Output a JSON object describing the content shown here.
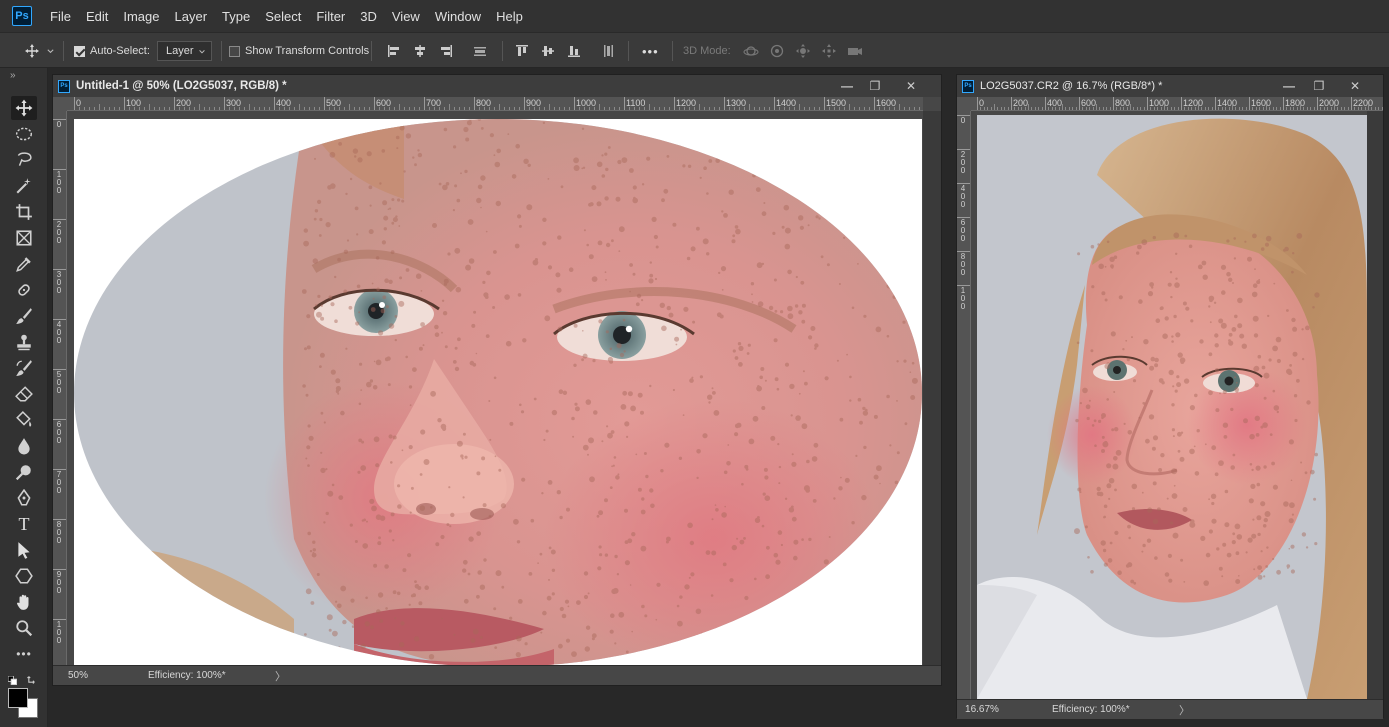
{
  "menu": [
    "File",
    "Edit",
    "Image",
    "Layer",
    "Type",
    "Select",
    "Filter",
    "3D",
    "View",
    "Window",
    "Help"
  ],
  "app_logo": "Ps",
  "options": {
    "auto_select_label": "Auto-Select:",
    "auto_select_checked": true,
    "auto_select_target": "Layer",
    "show_transform_label": "Show Transform Controls",
    "show_transform_checked": false,
    "more_label": "•••",
    "three_d_mode_label": "3D Mode:"
  },
  "toolbar": {
    "collapse_label": "»",
    "tools": [
      "move",
      "ellipse-marquee",
      "lasso",
      "magic-wand",
      "crop",
      "frame",
      "eyedropper",
      "healing",
      "brush",
      "clone-stamp",
      "history-brush",
      "eraser",
      "paint-bucket",
      "blur",
      "dodge",
      "pen",
      "type",
      "path-selection",
      "shape",
      "hand",
      "zoom",
      "more"
    ],
    "type_glyph": "T",
    "more_glyph": "•••",
    "foreground_color": "#000000",
    "background_color": "#ffffff"
  },
  "doc1": {
    "icon": "Ps",
    "title": "Untitled-1 @ 50% (LO2G5037, RGB/8) *",
    "ruler_h": [
      "0",
      "100",
      "200",
      "300",
      "400",
      "500",
      "600",
      "700",
      "800",
      "900",
      "1000",
      "1100",
      "1200",
      "1300",
      "1400",
      "1500",
      "1600"
    ],
    "ruler_v": [
      "0",
      "1\n0\n0",
      "2\n0\n0",
      "3\n0\n0",
      "4\n0\n0",
      "5\n0\n0",
      "6\n0\n0",
      "7\n0\n0",
      "8\n0\n0",
      "9\n0\n0",
      "1\n0\n0"
    ],
    "zoom": "50%",
    "efficiency": "Efficiency: 100%*",
    "arrow": "〉"
  },
  "doc2": {
    "icon": "Ps",
    "title": "LO2G5037.CR2 @ 16.7% (RGB/8*) *",
    "ruler_h": [
      "0",
      "200",
      "400",
      "600",
      "800",
      "1000",
      "1200",
      "1400",
      "1600",
      "1800",
      "2000",
      "2200"
    ],
    "ruler_v": [
      "0",
      "2\n0\n0",
      "4\n0\n0",
      "6\n0\n0",
      "8\n0\n0",
      "1\n0\n0"
    ],
    "zoom": "16.67%",
    "efficiency": "Efficiency: 100%*",
    "arrow": "〉"
  },
  "window_buttons": {
    "minimize": "—",
    "restore": "❐",
    "close": "✕"
  }
}
